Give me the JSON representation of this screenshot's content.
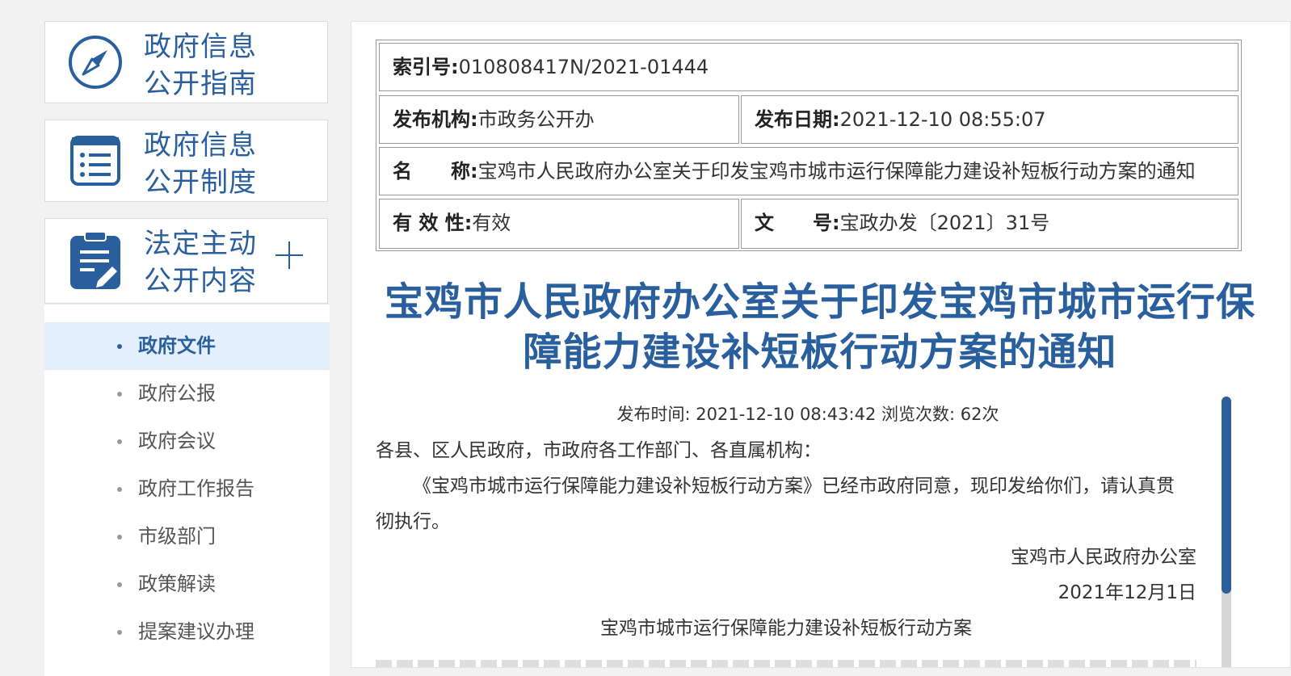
{
  "sidebar": {
    "cards": [
      {
        "line1": "政府信息",
        "line2": "公开指南",
        "icon": "compass-icon"
      },
      {
        "line1": "政府信息",
        "line2": "公开制度",
        "icon": "list-document-icon"
      },
      {
        "line1": "法定主动",
        "line2": "公开内容",
        "icon": "clipboard-edit-icon",
        "expand": "plus-icon"
      }
    ],
    "items": [
      {
        "label": "政府文件",
        "active": true
      },
      {
        "label": "政府公报"
      },
      {
        "label": "政府会议"
      },
      {
        "label": "政府工作报告"
      },
      {
        "label": "市级部门"
      },
      {
        "label": "政策解读"
      },
      {
        "label": "提案建议办理"
      }
    ]
  },
  "meta": {
    "index_label": "索引号:",
    "index_value": "010808417N/2021-01444",
    "org_label": "发布机构:",
    "org_value": "市政务公开办",
    "date_label": "发布日期:",
    "date_value": "2021-12-10 08:55:07",
    "name_label": "名　　称:",
    "name_value": "宝鸡市人民政府办公室关于印发宝鸡市城市运行保障能力建设补短板行动方案的通知",
    "validity_label": "有 效 性:",
    "validity_value": "有效",
    "docno_label": "文　　号:",
    "docno_value": "宝政办发〔2021〕31号"
  },
  "article": {
    "title_line1": "宝鸡市人民政府办公室关于印发宝鸡市城市运行保",
    "title_line2": "障能力建设补短板行动方案的通知",
    "pub_info": "发布时间: 2021-12-10 08:43:42 浏览次数: 62次",
    "salutation": "各县、区人民政府，市政府各工作部门、各直属机构：",
    "para1": "《宝鸡市城市运行保障能力建设补短板行动方案》已经市政府同意，现印发给你们，请认真贯",
    "para1_cont": "彻执行。",
    "signature": "宝鸡市人民政府办公室",
    "sign_date": "2021年12月1日",
    "attachment_title": "宝鸡市城市运行保障能力建设补短板行动方案"
  },
  "colors": {
    "brand": "#2a5f9e",
    "active_bg": "#e3f0fc"
  }
}
